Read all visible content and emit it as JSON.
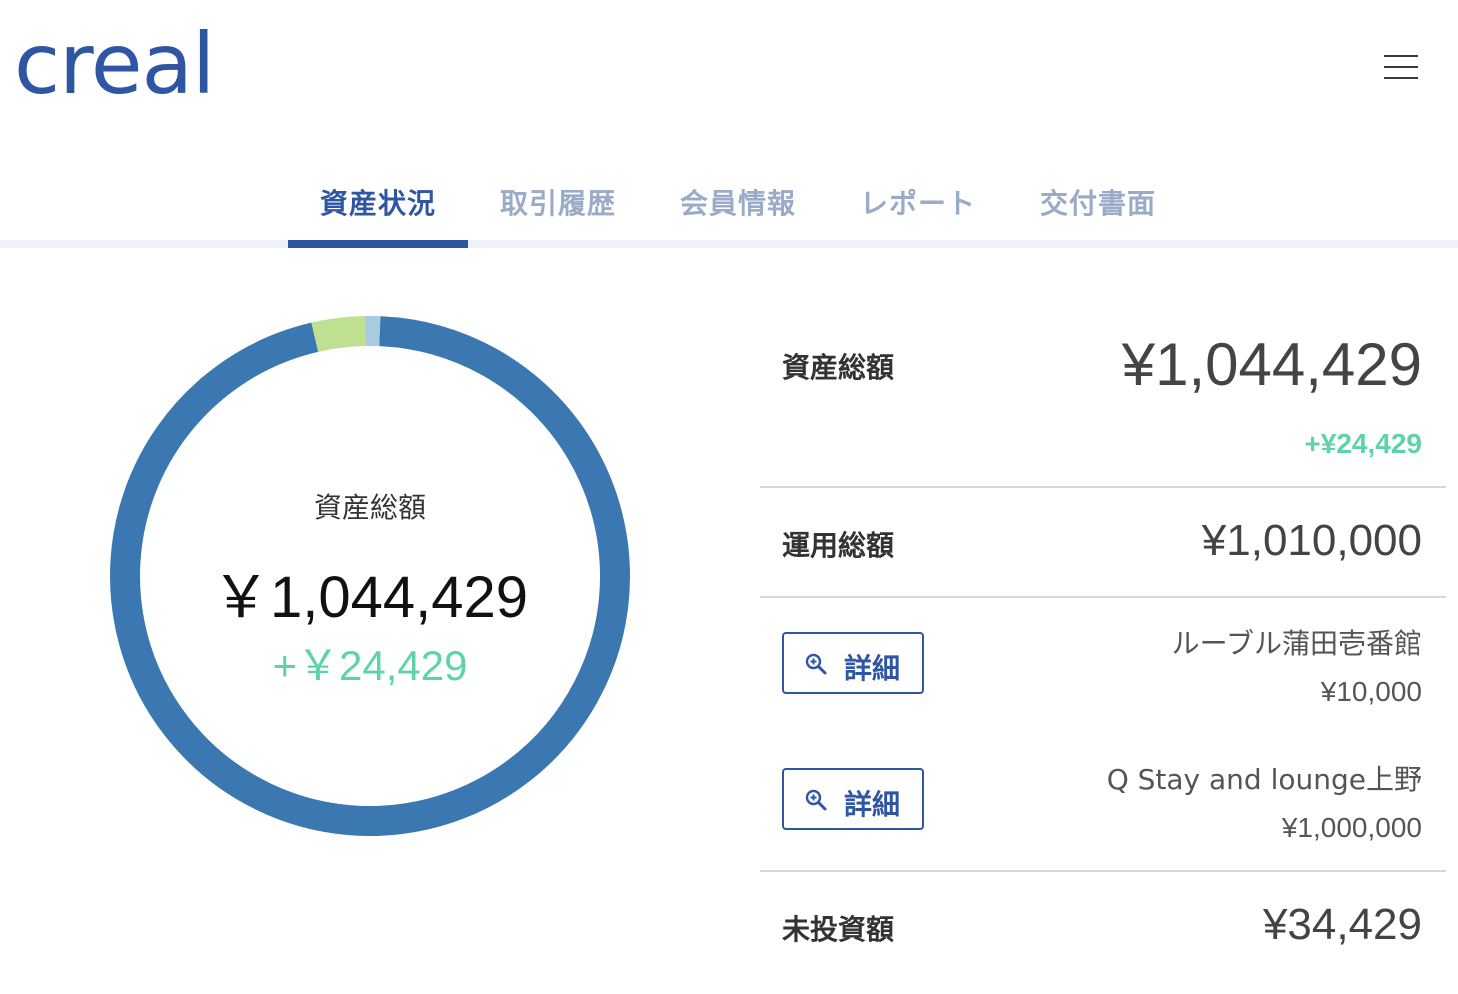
{
  "header": {
    "logo_text": "creal",
    "menu_icon": "hamburger-menu-icon"
  },
  "tabs": [
    {
      "label": "資産状況",
      "active": true
    },
    {
      "label": "取引履歴",
      "active": false
    },
    {
      "label": "会員情報",
      "active": false
    },
    {
      "label": "レポート",
      "active": false
    },
    {
      "label": "交付書面",
      "active": false
    }
  ],
  "donut": {
    "label": "資産総額",
    "total": "￥1,044,429",
    "gain": "+￥24,429"
  },
  "chart_data": {
    "type": "pie",
    "categories": [
      "Q Stay and lounge上野",
      "未投資額",
      "ルーブル蒲田壱番館"
    ],
    "values": [
      1000000,
      34429,
      10000
    ],
    "colors": [
      "#3b77b0",
      "#bfdf91",
      "#a9cbe2"
    ]
  },
  "summary": {
    "total_label": "資産総額",
    "total_value": "¥1,044,429",
    "total_gain": "+¥24,429",
    "invested_label": "運用総額",
    "invested_value": "¥1,010,000",
    "uninvested_label": "未投資額",
    "uninvested_value": "¥34,429"
  },
  "holdings": [
    {
      "name": "ルーブル蒲田壱番館",
      "amount": "¥10,000",
      "button_label": "詳細",
      "button_icon": "zoom-in-icon"
    },
    {
      "name": "Q Stay and lounge上野",
      "amount": "¥1,000,000",
      "button_label": "詳細",
      "button_icon": "zoom-in-icon"
    }
  ],
  "colors": {
    "brand": "#2f56a3",
    "tab_inactive": "#9aabc8",
    "gain": "#5ed3a9"
  }
}
